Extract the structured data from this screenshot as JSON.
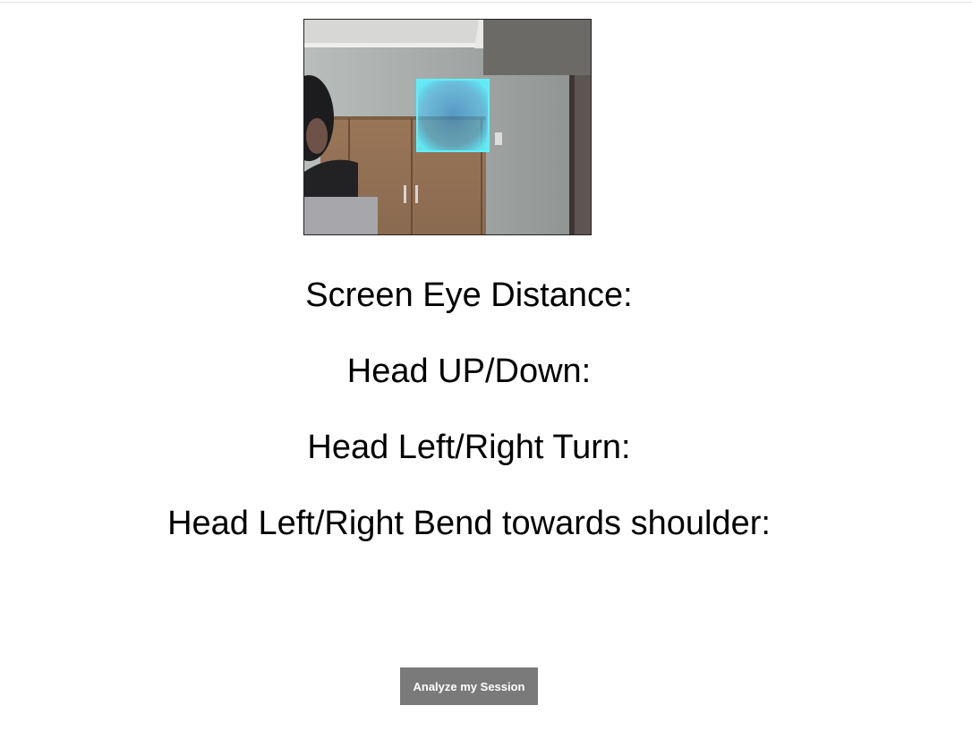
{
  "webcam": {
    "alt": "webcam-feed",
    "overlay_color": "#4fe8ff"
  },
  "metrics": {
    "screen_eye_distance_label": "Screen Eye Distance:",
    "head_up_down_label": "Head UP/Down:",
    "head_turn_label": "Head Left/Right Turn:",
    "head_bend_label": "Head Left/Right Bend towards shoulder:"
  },
  "actions": {
    "analyze_label": "Analyze my Session",
    "button_color": "#7a7a7a"
  }
}
